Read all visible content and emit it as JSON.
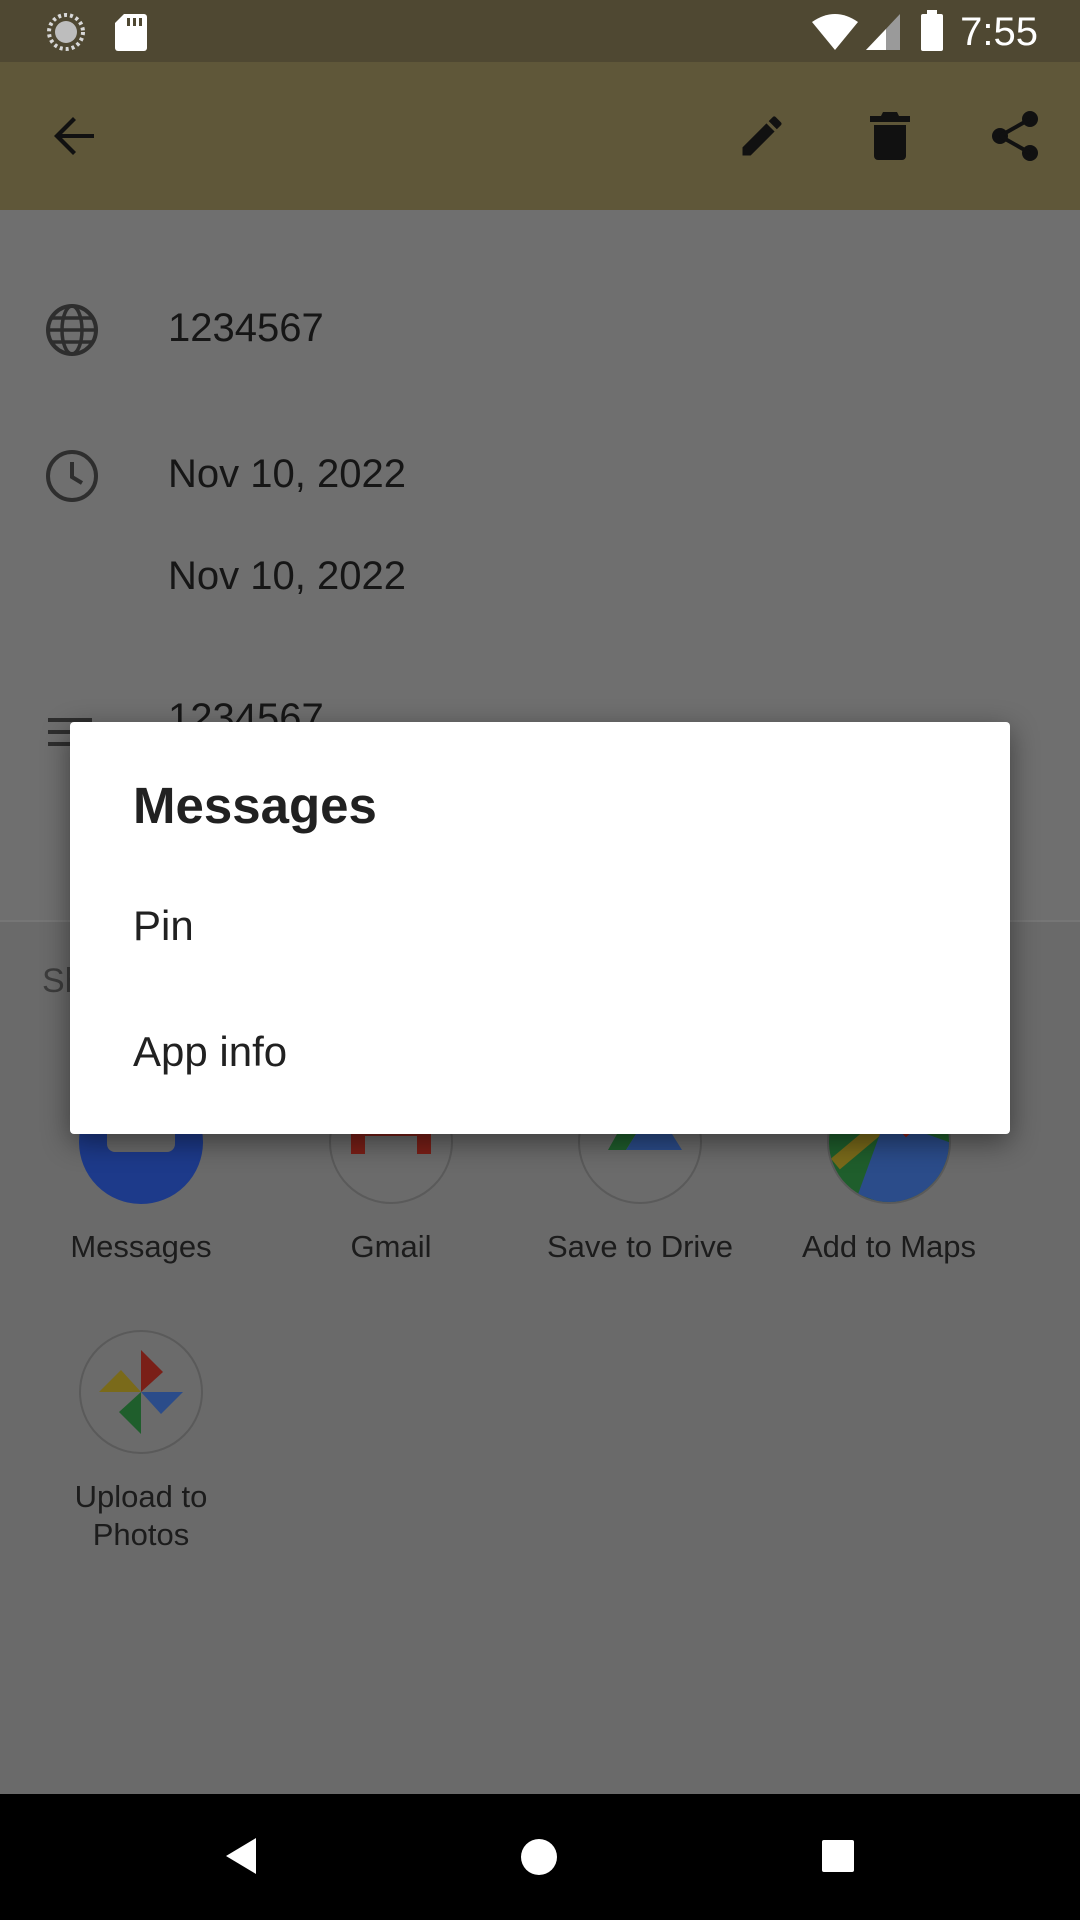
{
  "status_bar": {
    "time": "7:55"
  },
  "app_bar": {
    "back_icon": "arrow-back-icon",
    "edit_icon": "pencil-icon",
    "delete_icon": "trash-icon",
    "share_icon": "share-icon"
  },
  "details": {
    "number": "1234567",
    "date_start": "Nov 10, 2022",
    "date_end": "Nov 10, 2022",
    "description": "1234567"
  },
  "share_sheet": {
    "label": "Sh",
    "apps": [
      {
        "label": "Messages"
      },
      {
        "label": "Gmail"
      },
      {
        "label": "Save to Drive"
      },
      {
        "label": "Add to Maps"
      },
      {
        "label": "Upload to Photos"
      }
    ]
  },
  "dialog": {
    "title": "Messages",
    "items": [
      {
        "label": "Pin"
      },
      {
        "label": "App info"
      }
    ]
  },
  "colors": {
    "status_bar": "#4f4832",
    "app_bar": "#5f5739",
    "scrim_background": "#6b6b6b",
    "dialog_background": "#ffffff"
  }
}
